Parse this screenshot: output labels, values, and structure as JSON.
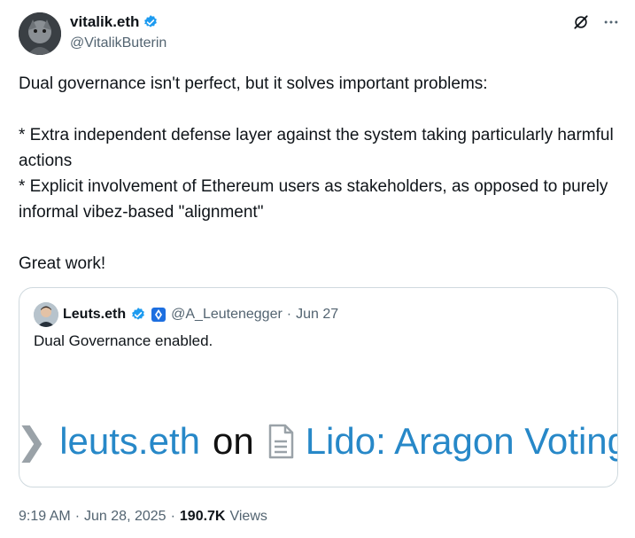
{
  "author": {
    "display_name": "vitalik.eth",
    "handle": "@VitalikButerin"
  },
  "tweet": {
    "text": "Dual governance isn't perfect, but it solves important problems:\n\n* Extra independent defense layer against the system taking particularly harmful actions\n* Explicit involvement of Ethereum users as stakeholders, as opposed to purely informal vibez-based \"alignment\"\n\nGreat work!"
  },
  "quoted": {
    "display_name": "Leuts.eth",
    "handle": "@A_Leutenegger",
    "separator": "·",
    "date": "Jun 27",
    "text": "Dual Governance enabled.",
    "media": {
      "left_text": "leuts.eth",
      "middle_text": "on",
      "right_text": "Lido: Aragon Voting"
    }
  },
  "footer": {
    "time": "9:19 AM",
    "sep1": "·",
    "date": "Jun 28, 2025",
    "sep2": "·",
    "views_count": "190.7K",
    "views_label": "Views"
  },
  "colors": {
    "verified": "#1d9bf0",
    "link": "#2788c8",
    "muted": "#536471"
  }
}
